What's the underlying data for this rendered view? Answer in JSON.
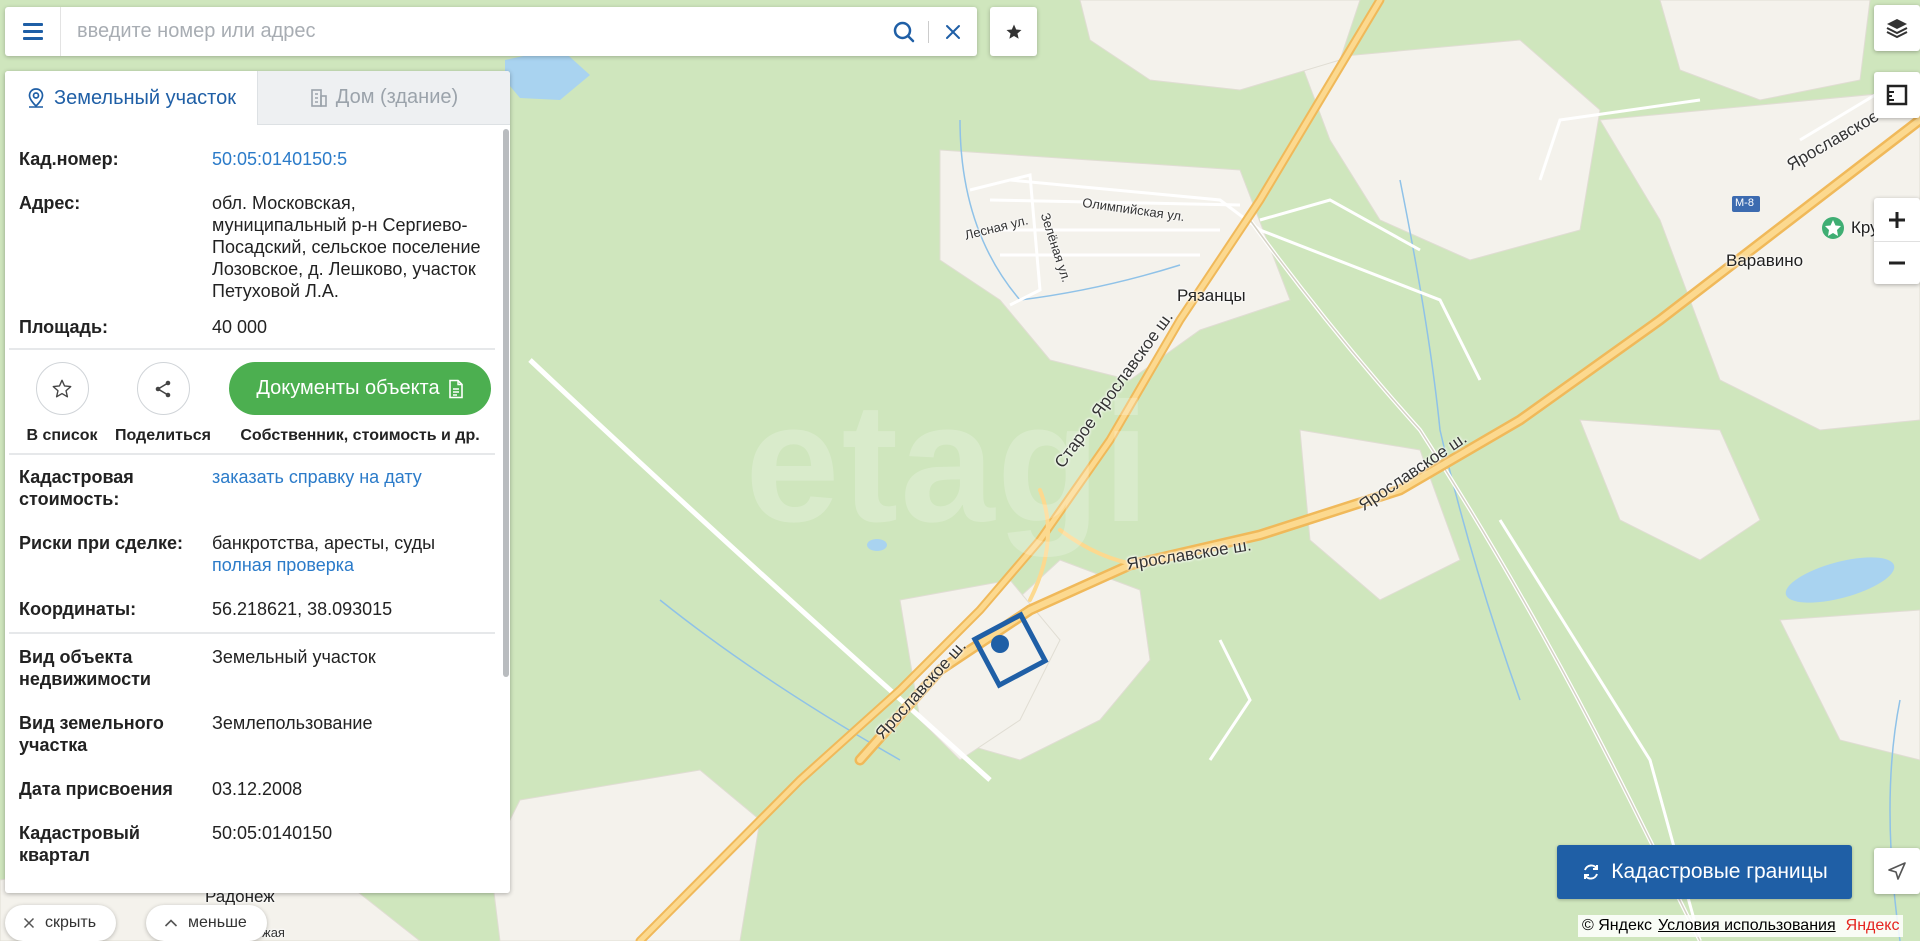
{
  "search": {
    "placeholder": "введите номер или адрес",
    "value": ""
  },
  "tabs": [
    {
      "label": "Земельный участок",
      "active": true,
      "icon": "map-pin-icon"
    },
    {
      "label": "Дом (здание)",
      "active": false,
      "icon": "building-icon"
    }
  ],
  "info": {
    "cad_number_label": "Кад.номер:",
    "cad_number": "50:05:0140150:5",
    "address_label": "Адрес:",
    "address": "обл. Московская, муниципальный р-н Сергиево-Посадский, сельское поселение Лозовское, д. Лешково, участок Петуховой Л.А.",
    "area_label": "Площадь:",
    "area": "40 000"
  },
  "actions": {
    "favorite_label": "В список",
    "share_label": "Поделиться",
    "docs_button": "Документы объекта",
    "docs_caption": "Собственник, стоимость и др."
  },
  "details": {
    "cad_cost_label": "Кадастровая стоимость:",
    "cad_cost_link": "заказать справку на дату",
    "risks_label": "Риски при сделке:",
    "risks_value": "банкротства, аресты, суды",
    "risks_link": "полная проверка",
    "coords_label": "Координаты:",
    "coords": "56.218621, 38.093015",
    "object_type_label": "Вид объекта недвижимости",
    "object_type": "Земельный участок",
    "land_type_label": "Вид земельного участка",
    "land_type": "Землепользование",
    "date_label": "Дата присвоения",
    "date": "03.12.2008",
    "quarter_label": "Кадастровый квартал",
    "quarter": "50:05:0140150"
  },
  "bottom": {
    "hide_label": "скрыть",
    "less_label": "меньше"
  },
  "map": {
    "watermark": "etagi",
    "labels": {
      "varavino": "Варавино",
      "ryazantsy": "Рязанцы",
      "olimp": "Олимпийская ул.",
      "lesnaya": "Лесная ул.",
      "zelenaya": "Зелёная ул.",
      "staroe": "Старое Ярославское ш.",
      "yar1": "Ярославское ш.",
      "yar2": "Ярославское ш.",
      "yar3": "Ярославское ш.",
      "yar4": "Ярославское ш.",
      "m8": "М-8",
      "kru": "Кру",
      "radonezh": "Радонеж",
      "bottom_partial": "жая"
    },
    "cadastre_button": "Кадастровые границы",
    "attribution_copy": "© Яндекс",
    "attribution_terms": "Условия использования",
    "attribution_brand": "Яндекс"
  },
  "colors": {
    "accent": "#1f5fa6",
    "link": "#2b7bc9",
    "docs_green": "#4caf50",
    "forest": "#cfe6bd",
    "field": "#f4f2ec",
    "road": "#f5c46a"
  }
}
